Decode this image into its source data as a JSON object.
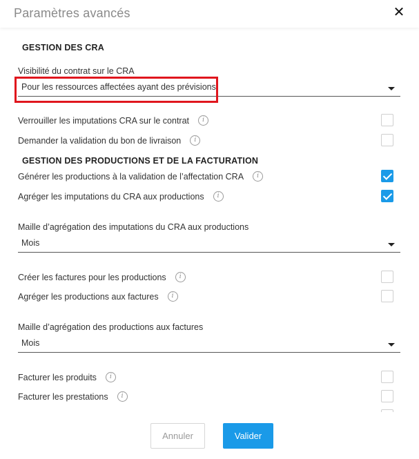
{
  "header": {
    "title": "Paramètres avancés",
    "close_glyph": "✕"
  },
  "sections": {
    "cra": "GESTION DES CRA",
    "productions": "GESTION DES PRODUCTIONS ET DE LA FACTURATION"
  },
  "visibility": {
    "label": "Visibilité du contrat sur le CRA",
    "value": "Pour les ressources affectées ayant des prévisions"
  },
  "options": [
    {
      "label": "Verrouiller les imputations CRA sur le contrat",
      "checked": false
    },
    {
      "label": "Demander la validation du bon de livraison",
      "checked": false
    },
    {
      "label": "Générer les productions à la validation de l’affectation CRA",
      "checked": true
    },
    {
      "label": "Agréger les imputations du CRA aux productions",
      "checked": true
    },
    {
      "label": "Créer les factures pour les productions",
      "checked": false
    },
    {
      "label": "Agréger les productions aux factures",
      "checked": false
    },
    {
      "label": "Facturer les produits",
      "checked": false
    },
    {
      "label": "Facturer les prestations",
      "checked": false
    }
  ],
  "maille_cra": {
    "label": "Maille d’agrégation des imputations du CRA aux productions",
    "value": "Mois"
  },
  "maille_factures": {
    "label": "Maille d’agrégation des productions aux factures",
    "value": "Mois"
  },
  "info_glyph": "i",
  "footer": {
    "cancel_label": "Annuler",
    "ok_label": "Valider"
  },
  "colors": {
    "accent": "#1a9ae8",
    "highlight": "#e0161d"
  }
}
